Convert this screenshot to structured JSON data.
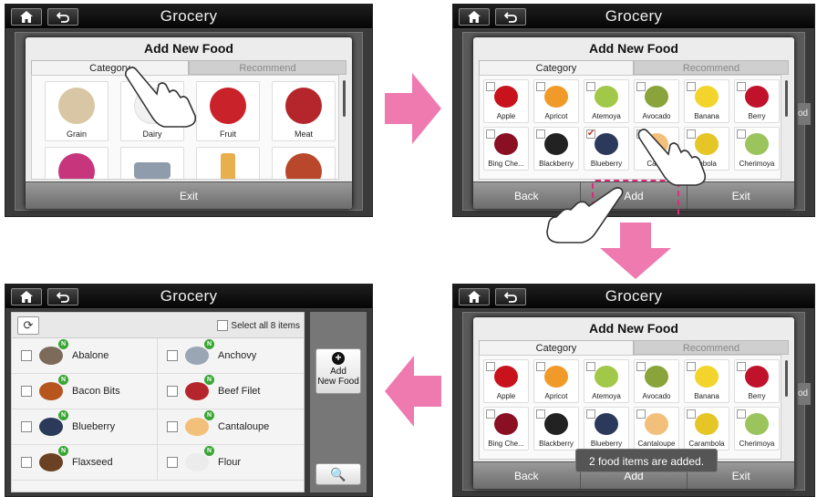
{
  "app_title": "Grocery",
  "dialog": {
    "title": "Add New Food",
    "tab_category": "Category",
    "tab_recommend": "Recommend"
  },
  "categories": [
    {
      "label": "Grain",
      "color": "#d8c6a4"
    },
    {
      "label": "Dairy",
      "color": "#f1f1f1"
    },
    {
      "label": "Fruit",
      "color": "#c9222a"
    },
    {
      "label": "Meat",
      "color": "#b5262c"
    },
    {
      "label": "",
      "color": "#c7357d"
    },
    {
      "label": "",
      "color": "#8e9cab"
    },
    {
      "label": "",
      "color": "#e8b04c"
    },
    {
      "label": "",
      "color": "#b8472c"
    }
  ],
  "foods": [
    {
      "label": "Apple",
      "color": "#c8121c",
      "checked": false
    },
    {
      "label": "Apricot",
      "color": "#f09a2a",
      "checked": false
    },
    {
      "label": "Atemoya",
      "color": "#a2c84a",
      "checked": false
    },
    {
      "label": "Avocado",
      "color": "#8aa33a",
      "checked": false
    },
    {
      "label": "Banana",
      "color": "#f3d42c",
      "checked": false
    },
    {
      "label": "Berry",
      "color": "#c0122a",
      "checked": false
    },
    {
      "label": "Bing Che...",
      "color": "#8a0f22",
      "checked": false
    },
    {
      "label": "Blackberry",
      "color": "#222",
      "checked": false
    },
    {
      "label": "Blueberry",
      "color": "#2b3a5a",
      "checked": true
    },
    {
      "label": "Cantaloupe",
      "color": "#f2c07a",
      "checked": true
    },
    {
      "label": "Carambola",
      "color": "#e6c526",
      "checked": false
    },
    {
      "label": "Cherimoya",
      "color": "#9bc45c",
      "checked": false
    }
  ],
  "s2_food_labels": [
    "Apple",
    "Apricot",
    "Atemoya",
    "Avocado",
    "Banana",
    "Berry",
    "Bing Che...",
    "Blackberry",
    "Blueberry",
    "Canta",
    "mbola",
    "Cherimoya"
  ],
  "buttons": {
    "exit": "Exit",
    "back": "Back",
    "add": "Add"
  },
  "toast": "2 food items are added.",
  "list": {
    "select_all": "Select all 8 items",
    "add_new_food": "Add New Food",
    "add_new_food_l1": "Add",
    "add_new_food_l2": "New Food",
    "items": [
      {
        "label": "Abalone",
        "color": "#7c6a5a"
      },
      {
        "label": "Anchovy",
        "color": "#9aa6b4"
      },
      {
        "label": "Bacon Bits",
        "color": "#b7551f"
      },
      {
        "label": "Beef Filet",
        "color": "#b5262c"
      },
      {
        "label": "Blueberry",
        "color": "#2b3a5a"
      },
      {
        "label": "Cantaloupe",
        "color": "#f2c07a"
      },
      {
        "label": "Flaxseed",
        "color": "#6b4124"
      },
      {
        "label": "Flour",
        "color": "#ececec"
      }
    ],
    "badge": "N"
  },
  "bg_side_text": "od",
  "colors": {
    "arrow": "#ee7ab0",
    "dash": "#e0297a"
  }
}
